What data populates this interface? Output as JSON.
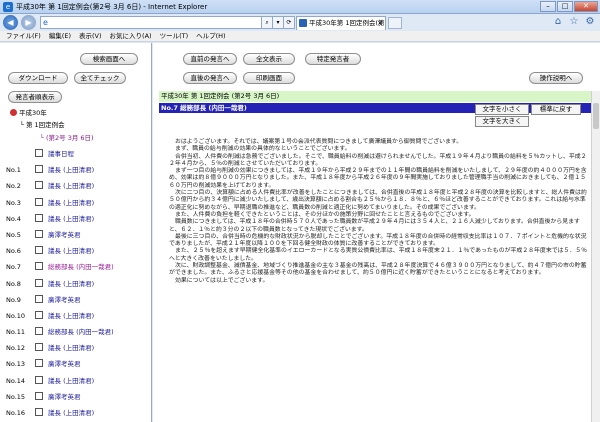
{
  "window": {
    "title": "平成30年 第 1回定例会(第2号 3月 6日) - Internet Explorer",
    "minimize": "–",
    "maximize": "□",
    "close": "✕"
  },
  "browser": {
    "back": "◀",
    "forward": "▶",
    "ie_icon": "e",
    "tools": [
      "⌕",
      "▾",
      "⟳"
    ],
    "tab_title": "平成30年第 1回定例会(第2...",
    "tab_close": "×",
    "right_icons": [
      "⌂",
      "☆",
      "⚙"
    ]
  },
  "menu": [
    "ファイル(F)",
    "編集(E)",
    "表示(V)",
    "お気に入り(A)",
    "ツール(T)",
    "ヘルプ(H)"
  ],
  "left": {
    "buttons": {
      "search_screen": "検索画面へ",
      "download": "ダウンロード",
      "check_all": "全てチェック",
      "display_speaker": "発言者順表示"
    },
    "tree": {
      "root": "平成30年",
      "session": "└ 第 1回定例会",
      "date": "└ (第2号 3月 6日)",
      "items": [
        {
          "num": "",
          "label": "議事日程",
          "hl": false
        },
        {
          "num": "No.1",
          "label": "議長 (上田清君)",
          "hl": false
        },
        {
          "num": "No.2",
          "label": "議長 (上田清君)",
          "hl": false
        },
        {
          "num": "No.3",
          "label": "議長 (上田清君)",
          "hl": false
        },
        {
          "num": "No.4",
          "label": "議長 (上田清君)",
          "hl": false
        },
        {
          "num": "No.5",
          "label": "廣澤考英君",
          "hl": false
        },
        {
          "num": "No.6",
          "label": "議長 (上田清君)",
          "hl": false
        },
        {
          "num": "No.7",
          "label": "総務部長 (内田一哉君)",
          "hl": true
        },
        {
          "num": "No.8",
          "label": "議長 (上田清君)",
          "hl": false
        },
        {
          "num": "No.9",
          "label": "廣澤考英君",
          "hl": false
        },
        {
          "num": "No.10",
          "label": "議長 (上田清君)",
          "hl": false
        },
        {
          "num": "No.11",
          "label": "総務部長 (内田一哉君)",
          "hl": false
        },
        {
          "num": "No.12",
          "label": "議長 (上田清君)",
          "hl": false
        },
        {
          "num": "No.13",
          "label": "廣澤考英君",
          "hl": false
        },
        {
          "num": "No.14",
          "label": "議長 (上田清君)",
          "hl": false
        },
        {
          "num": "No.15",
          "label": "廣澤考英君",
          "hl": false
        },
        {
          "num": "No.16",
          "label": "議長 (上田清君)",
          "hl": false
        }
      ]
    }
  },
  "right": {
    "buttons": {
      "prev_speech": "直前の発言へ",
      "show_all": "全文表示",
      "specific_speaker": "特定発言者",
      "next_speech": "直後の発言へ",
      "print_screen": "印刷画面",
      "help": "操作説明へ"
    },
    "session_header": "平成30年 第 1回定例会 (第2号 3月 6日)",
    "speaker": "No.7 総務部長 (内田一哉君)",
    "font": {
      "smaller": "文字を小さく",
      "standard": "標準に戻す",
      "larger": "文字を大きく"
    },
    "paragraphs": [
      "おはようございます。それでは、議案第１号の会派代表質問につきまして廣澤議員から御質問でございます。",
      "まず、職員の給与削減の効果の具体的なということでございます。",
      "合併当初、人件費の削減は急務でございました。そこで、職員給料の削減は避けられませんでした。平成１９年４月より職員の給料を５％カットし、平成２２年４月から、５％の削減とさせていただいております。",
      "まず一つ目の給与削減の効果につきましては、平成１９年から平成２９年までの１１年間の職員給料を削減をいたしまして、２９年度の約４０００万円を含め、効果は約８億９０００万円となりました。また、平成１８年度から平成２６年度の９年間実施しておりました管理職手当の削減におきましても、２億１５６０万円の削減効果を上げております。",
      "次に二つ目の、決算額に占める人件費比率が改善をしたことにつきましては、合併直後の平成１８年度と平成２８年度の決算を比較しますと、総人件費は約５０億円から約３４億円に減少いたしまして、歳出決算額に占める割合も２５％から１８．８％と、６％ほど改善することができております。これは給与水準の適正化に努めながら、早期退職の推進など、職員数の削減と適正化に努めてまいりました。その成果でございます。",
      "また、人件費の負担を軽くできたということは、その分ほかの施策分野に回せたことと言えるものでございます。",
      "職員数につきましては、平成１８年の合併時５７０人であった職員数が平成２９年４月には３５４人と、２１６人減少しております。合併直後から見ますと、６２．１％と約３分の２以下の職員数となってきた現状でございます。",
      "最後に三つ目の、合併当時の危機的な財政状況から脱却したことでございます。平成１８年度の合併時の経常収支比率は１０７．７ポイントと危機的な状況でありましたが、平成２１年度以降１００を下回る健全財政の体質に改善することができております。",
      "また、２５％を超えます早期健全化基準のイエローカードとなる実質公債費比率は、平成１８年度末２１．１％であったものが平成２８年度末では５．５％へと大きく改善をいたしました。",
      "次に、財政調整基金、減債基金、地域づくり推進基金の主な３基金の残高は、平成２８年度決算で４６億３９００万円となりまして、約４７億円の市の貯蓄ができました。また、ふるさと応援基金等その他の基金を合わせまして、約５０億円に近く貯蓄ができたということになると考えております。",
      "効果については以上でございます。"
    ]
  }
}
